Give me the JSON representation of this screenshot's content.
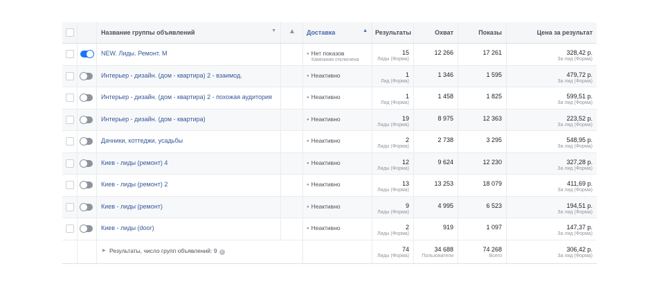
{
  "header": {
    "name": "Название группы объявлений",
    "delivery": "Доставка",
    "results": "Результаты",
    "reach": "Охват",
    "impressions": "Показы",
    "cost": "Цена за результат",
    "warning_icon": "warning-triangle-icon",
    "sort_down_icon": "caret-down-icon",
    "sort_up_icon": "caret-up-icon"
  },
  "accent_color": "#1877f2",
  "rows": [
    {
      "on": true,
      "name": "NEW. Лиды. Ремонт. М",
      "status": "Нет показов",
      "status_sub": "Кампания отключена",
      "results": "15",
      "results_sub": "Лиды (Форма)",
      "reach": "12 266",
      "impressions": "17 261",
      "cost": "328,42 р.",
      "cost_sub": "За лид (Форма)"
    },
    {
      "on": false,
      "name": "Интерьер - дизайн. (дом - квартира) 2 - взаимод.",
      "status": "Неактивно",
      "results": "1",
      "results_sub": "Лид (Форма)",
      "reach": "1 346",
      "impressions": "1 595",
      "cost": "479,72 р.",
      "cost_sub": "За лид (Форма)"
    },
    {
      "on": false,
      "name": "Интерьер - дизайн. (дом - квартира) 2 - похожая аудитория",
      "status": "Неактивно",
      "results": "1",
      "results_sub": "Лид (Форма)",
      "reach": "1 458",
      "impressions": "1 825",
      "cost": "599,51 р.",
      "cost_sub": "За лид (Форма)"
    },
    {
      "on": false,
      "name": "Интерьер - дизайн. (дом - квартира)",
      "status": "Неактивно",
      "results": "19",
      "results_sub": "Лиды (Форма)",
      "reach": "8 975",
      "impressions": "12 363",
      "cost": "223,52 р.",
      "cost_sub": "За лид (Форма)"
    },
    {
      "on": false,
      "name": "Дачники, коттеджи, усадьбы",
      "status": "Неактивно",
      "results": "2",
      "results_sub": "Лиды (Форма)",
      "reach": "2 738",
      "impressions": "3 295",
      "cost": "548,95 р.",
      "cost_sub": "За лид (Форма)"
    },
    {
      "on": false,
      "name": "Киев - лиды (ремонт) 4",
      "status": "Неактивно",
      "results": "12",
      "results_sub": "Лиды (Форма)",
      "reach": "9 624",
      "impressions": "12 230",
      "cost": "327,28 р.",
      "cost_sub": "За лид (Форма)"
    },
    {
      "on": false,
      "name": "Киев - лиды (ремонт) 2",
      "status": "Неактивно",
      "results": "13",
      "results_sub": "Лиды (Форма)",
      "reach": "13 253",
      "impressions": "18 079",
      "cost": "411,69 р.",
      "cost_sub": "За лид (Форма)"
    },
    {
      "on": false,
      "name": "Киев - лиды (ремонт)",
      "status": "Неактивно",
      "results": "9",
      "results_sub": "Лиды (Форма)",
      "reach": "4 995",
      "impressions": "6 523",
      "cost": "194,51 р.",
      "cost_sub": "За лид (Форма)"
    },
    {
      "on": false,
      "name": "Киев - лиды (door)",
      "status": "Неактивно",
      "results": "2",
      "results_sub": "Лиды (Форма)",
      "reach": "919",
      "impressions": "1 097",
      "cost": "147,37 р.",
      "cost_sub": "За лид (Форма)"
    }
  ],
  "summary": {
    "label": "Результаты, число групп объявлений: 9",
    "results": "74",
    "results_sub": "Лиды (Форма)",
    "reach": "34 688",
    "reach_sub": "Пользователи",
    "impressions": "74 268",
    "impressions_sub": "Всего",
    "cost": "306,42 р.",
    "cost_sub": "За лид (Форма)",
    "info_icon": "info-icon"
  }
}
